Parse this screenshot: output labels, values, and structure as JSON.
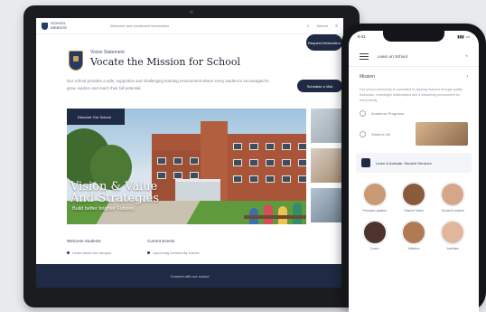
{
  "laptop": {
    "brand": "SCHOOL WEBSITE",
    "nav_text": "Welcome and enrollment information",
    "nav_right": [
      "Search",
      "Menu"
    ],
    "small_title": "Vision Statement",
    "site_title": "Vocate the Mission for School",
    "top_button": "Request Information",
    "mid_button": "Schedule a Visit",
    "intro": "Our school provides a safe, supportive and challenging learning environment where every student is encouraged to grow, explore and reach their full potential.",
    "hero_label": "Discover Our School",
    "hero_heading": [
      "Vision & Value",
      "And Strategies"
    ],
    "hero_sub": "Build better brighter Futures",
    "lower_cols": [
      {
        "title": "Welcome Students",
        "line": "Learn about the campus"
      },
      {
        "title": "Current Events",
        "line": "Upcoming community events"
      }
    ],
    "footer": "Connect with our school"
  },
  "phone": {
    "status_time": "9:41",
    "header_title": "Learn on School",
    "section_title": "Mission",
    "section_text": "Our school community is committed to inspiring learners through quality instruction, meaningful relationships and a welcoming environment for every family.",
    "row1": "Academic Programs",
    "row2": "Student Life",
    "feature": "Learn & Activate: Student Services",
    "avatars": [
      {
        "name": "Principal Updates",
        "color": "#c99a74"
      },
      {
        "name": "Teacher Notes",
        "color": "#8a5a3c"
      },
      {
        "name": "Student Leaders",
        "color": "#d7a68a"
      },
      {
        "name": "Coach",
        "color": "#4e342e"
      },
      {
        "name": "Athletics",
        "color": "#b07a55"
      },
      {
        "name": "Activities",
        "color": "#e0b79b"
      }
    ]
  },
  "colors": {
    "navy": "#1f2b44",
    "gold": "#c9a24a",
    "brick": "#a9553a"
  }
}
